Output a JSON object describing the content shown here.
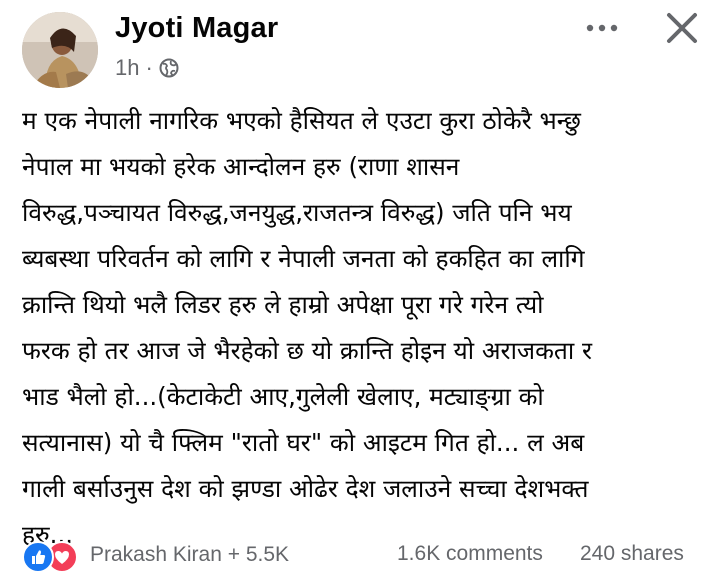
{
  "post": {
    "author_name": "Jyoti Magar",
    "time_ago": "1h",
    "separator": "·",
    "audience_icon": "globe-icon",
    "more_icon": "more-horizontal-icon",
    "close_icon": "close-icon",
    "text_lines": [
      "म एक नेपाली नागरिक भएको हैसियत ले एउटा कुरा ठोकेरै भन्छु",
      "नेपाल मा भयको हरेक आन्दोलन हरु (राणा शासन",
      "विरुद्ध,पञ्चायत विरुद्ध,जनयुद्ध,राजतन्त्र विरुद्ध) जति पनि भय",
      "ब्यबस्था परिवर्तन को लागि र नेपाली जनता को हकहित का लागि",
      "क्रान्ति थियो भलै लिडर हरु ले हाम्रो अपेक्षा पूरा गरे गरेन त्यो",
      "फरक हो तर आज जे भैरहेको छ यो क्रान्ति होइन यो अराजकता र",
      "भाड भैलो हो...(केटाकेटी आए,गुलेली खेलाए, मट्याङ्ग्रा को",
      "सत्यानास) यो चै फ्लिम \"रातो घर\" को आइटम गित हो... ल अब",
      "गाली बर्साउनुस देश को झण्डा ओढेर देश जलाउने सच्चा देशभक्त",
      "हरु..."
    ]
  },
  "footer": {
    "reaction_icons": [
      "like-icon",
      "love-icon"
    ],
    "reactions_label": "Prakash Kiran + 5.5K",
    "comments_label": "1.6K comments",
    "shares_label": "240 shares"
  },
  "colors": {
    "text_primary": "#050505",
    "text_secondary": "#65676b",
    "like_blue": "#1877f2",
    "love_red": "#f33e58"
  }
}
